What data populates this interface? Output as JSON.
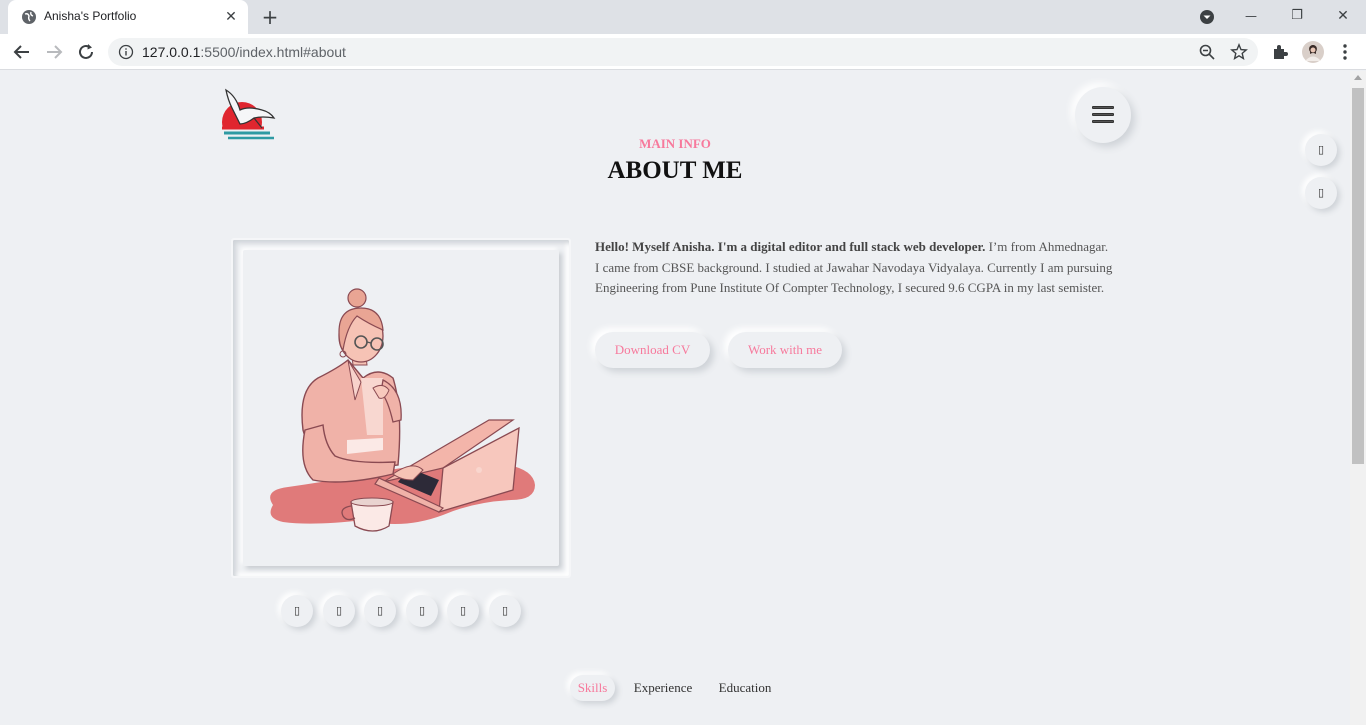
{
  "browser": {
    "tab_title": "Anisha's Portfolio",
    "tab_close": "✕",
    "new_tab": "+",
    "url_host": "127.0.0.1",
    "url_rest": ":5500/index.html#about",
    "window_controls": {
      "minimize": "—",
      "restore": "❐",
      "close": "✕"
    },
    "icons": [
      "globe-icon",
      "back-icon",
      "forward-icon",
      "reload-icon",
      "info-icon",
      "zoom-icon",
      "star-icon",
      "extensions-icon",
      "profile-avatar",
      "more-icon"
    ]
  },
  "header": {
    "logo_icon": "bird-sunset-logo",
    "menu_icon": "hamburger-icon"
  },
  "side_buttons": [
    {
      "icon": "mobile-icon",
      "glyph": "▯"
    },
    {
      "icon": "mobile-icon",
      "glyph": "▯"
    }
  ],
  "section": {
    "tag": "MAIN INFO",
    "title": "ABOUT ME"
  },
  "about": {
    "intro_bold": "Hello! Myself Anisha. I'm a digital editor and full stack web developer.",
    "intro_rest": " I’m from Ahmednagar. I came from CBSE background. I studied at Jawahar Navodaya Vidyalaya. Currently I am pursuing Engineering from Pune Institute Of Compter Technology, I secured 9.6 CGPA in my last semister.",
    "download_cv": "Download CV",
    "work_with_me": "Work with me"
  },
  "social_buttons": [
    "▯",
    "▯",
    "▯",
    "▯",
    "▯",
    "▯"
  ],
  "tabs": [
    {
      "label": "Skills",
      "active": true
    },
    {
      "label": "Experience",
      "active": false
    },
    {
      "label": "Education",
      "active": false
    }
  ],
  "colors": {
    "accent": "#f7799c",
    "background": "#eef0f3"
  }
}
